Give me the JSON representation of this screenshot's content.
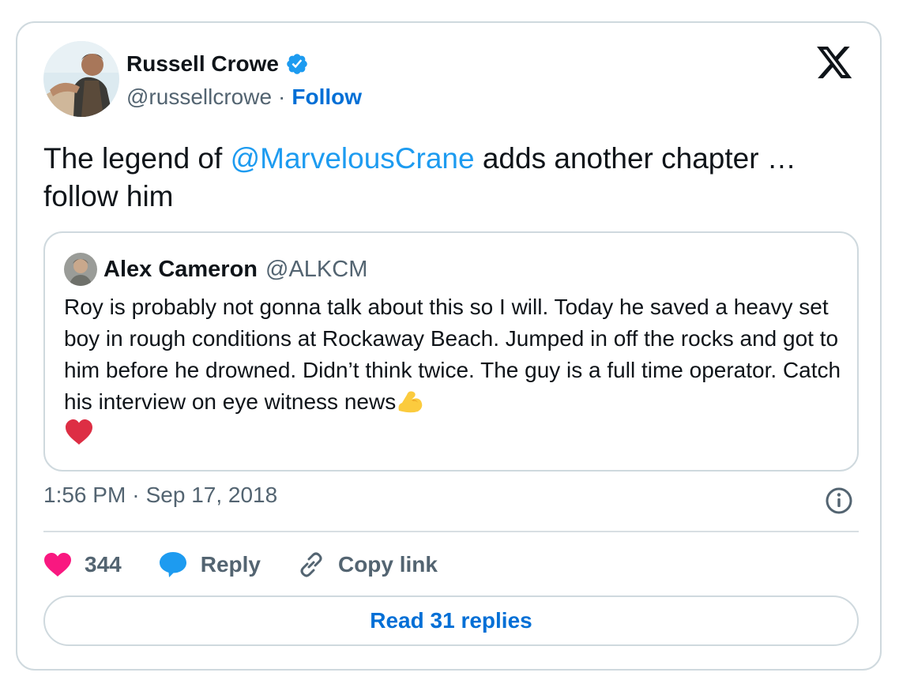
{
  "author": {
    "display_name": "Russell Crowe",
    "handle": "@russellcrowe",
    "separator": "·",
    "follow_label": "Follow",
    "verified": true
  },
  "tweet": {
    "text_before": "The legend of ",
    "mention": "@MarvelousCrane",
    "text_after": " adds another chapter … follow him"
  },
  "quoted_tweet": {
    "display_name": "Alex Cameron",
    "handle": "@ALKCM",
    "text": "Roy is probably not gonna talk about this so I will. Today he saved a heavy set boy in rough conditions at Rockaway Beach. Jumped in off the rocks and got to him before he drowned. Didn’t think twice. The guy is a full time operator. Catch his interview on eye witness news",
    "emojis": [
      "flexed-biceps",
      "red-heart"
    ]
  },
  "timestamp": {
    "time": "1:56 PM",
    "separator": "·",
    "date": "Sep 17, 2018"
  },
  "actions": {
    "likes_count": "344",
    "reply_label": "Reply",
    "copy_link_label": "Copy link"
  },
  "read_replies_label": "Read 31 replies",
  "colors": {
    "link_blue": "#006fd6",
    "mention_blue": "#1d9bf0",
    "like_pink": "#f91880",
    "reply_blue": "#1d9bf0",
    "secondary_text": "#536471",
    "border": "#cfd9de"
  },
  "icons": {
    "verified": "verified-badge-icon",
    "platform": "x-logo-icon",
    "info": "info-icon",
    "like": "heart-icon",
    "reply": "speech-bubble-icon",
    "copy_link": "link-icon"
  }
}
